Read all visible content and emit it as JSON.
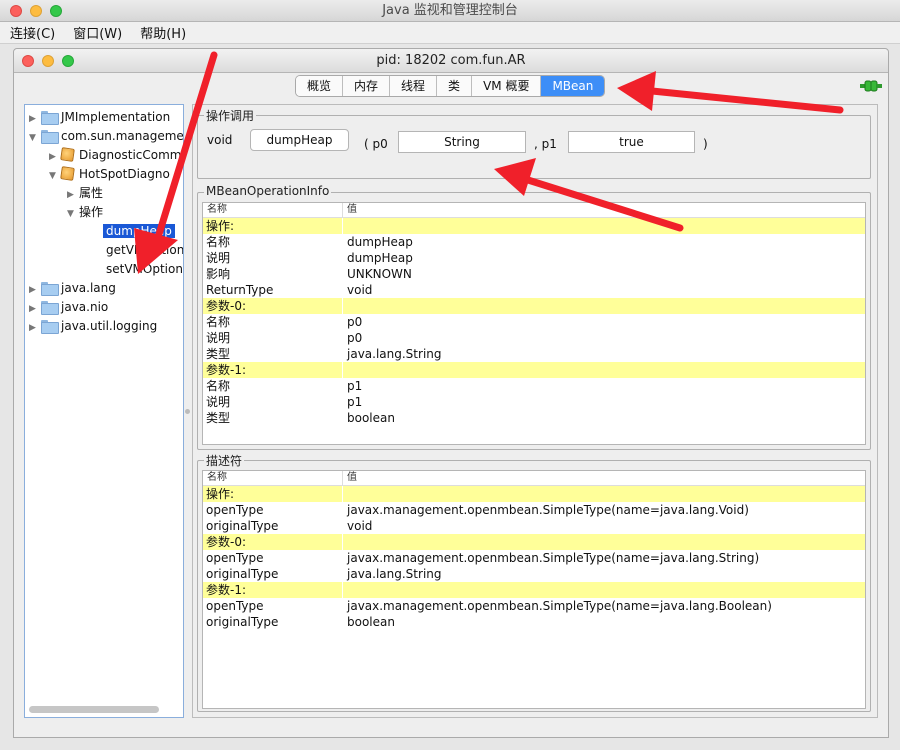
{
  "window": {
    "title": "Java 监视和管理控制台"
  },
  "menubar": [
    {
      "label": "连接(C)"
    },
    {
      "label": "窗口(W)"
    },
    {
      "label": "帮助(H)"
    }
  ],
  "inner": {
    "title": "pid: 18202 com.fun.AR"
  },
  "tabs": [
    {
      "label": "概览"
    },
    {
      "label": "内存"
    },
    {
      "label": "线程"
    },
    {
      "label": "类"
    },
    {
      "label": "VM 概要"
    },
    {
      "label": "MBean",
      "active": true
    }
  ],
  "tree": [
    {
      "label": "JMImplementation"
    },
    {
      "label": "com.sun.manageme"
    },
    {
      "label": "DiagnosticComm"
    },
    {
      "label": "HotSpotDiagno"
    },
    {
      "label": "属性"
    },
    {
      "label": "操作"
    },
    {
      "label": "dumpHeap"
    },
    {
      "label": "getVMOption"
    },
    {
      "label": "setVMOption"
    },
    {
      "label": "java.lang"
    },
    {
      "label": "java.nio"
    },
    {
      "label": "java.util.logging"
    }
  ],
  "invoke": {
    "group_label": "操作调用",
    "return_type": "void",
    "button": "dumpHeap",
    "open_paren": "( p0",
    "p0_value": "String",
    "sep": ", p1",
    "p1_value": "true",
    "close_paren": ")"
  },
  "opinfo": {
    "group_label": "MBeanOperationInfo",
    "col_name": "名称",
    "col_value": "值",
    "rows": [
      {
        "k": "操作:",
        "v": "",
        "hl": true
      },
      {
        "k": "名称",
        "v": "dumpHeap"
      },
      {
        "k": "说明",
        "v": "dumpHeap"
      },
      {
        "k": "影响",
        "v": "UNKNOWN"
      },
      {
        "k": "ReturnType",
        "v": "void"
      },
      {
        "k": "参数-0:",
        "v": "",
        "hl": true
      },
      {
        "k": "名称",
        "v": "p0"
      },
      {
        "k": "说明",
        "v": "p0"
      },
      {
        "k": "类型",
        "v": "java.lang.String"
      },
      {
        "k": "参数-1:",
        "v": "",
        "hl": true
      },
      {
        "k": "名称",
        "v": "p1"
      },
      {
        "k": "说明",
        "v": "p1"
      },
      {
        "k": "类型",
        "v": "boolean"
      }
    ]
  },
  "descriptor": {
    "group_label": "描述符",
    "col_name": "名称",
    "col_value": "值",
    "rows": [
      {
        "k": "操作:",
        "v": "",
        "hl": true
      },
      {
        "k": "openType",
        "v": "javax.management.openmbean.SimpleType(name=java.lang.Void)"
      },
      {
        "k": "originalType",
        "v": "void"
      },
      {
        "k": "参数-0:",
        "v": "",
        "hl": true
      },
      {
        "k": "openType",
        "v": "javax.management.openmbean.SimpleType(name=java.lang.String)"
      },
      {
        "k": "originalType",
        "v": "java.lang.String"
      },
      {
        "k": "参数-1:",
        "v": "",
        "hl": true
      },
      {
        "k": "openType",
        "v": "javax.management.openmbean.SimpleType(name=java.lang.Boolean)"
      },
      {
        "k": "originalType",
        "v": "boolean"
      }
    ]
  },
  "colors": {
    "accent": "#3d8ef7",
    "selection": "#1a58d6",
    "highlight_row": "#ffff99",
    "annotation_arrow": "#f0202a"
  }
}
